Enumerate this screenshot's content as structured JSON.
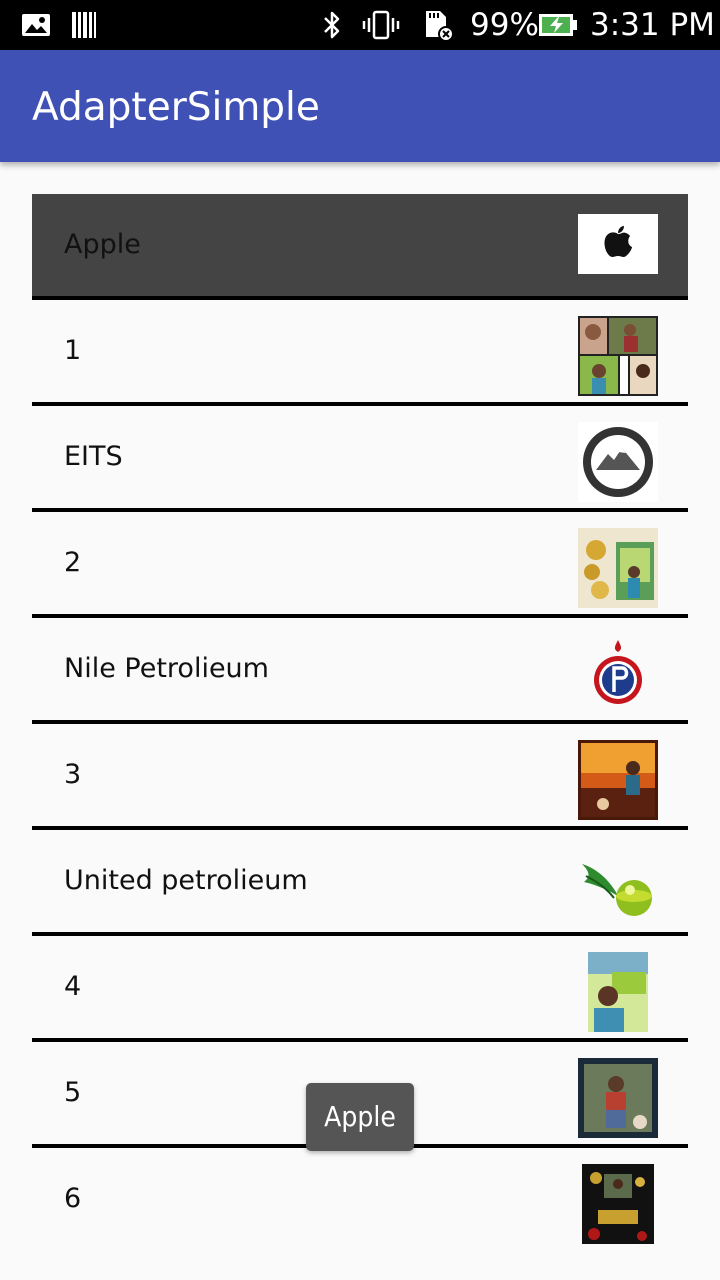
{
  "status_bar": {
    "battery_percent": "99%",
    "time": "3:31 PM",
    "icons": [
      "image-icon",
      "barcode-icon",
      "bluetooth-icon",
      "vibrate-icon",
      "sd-card-error-icon",
      "battery-charging-icon"
    ]
  },
  "app_bar": {
    "title": "AdapterSimple"
  },
  "list": {
    "items": [
      {
        "label": "Apple",
        "selected": true,
        "image": "apple-logo"
      },
      {
        "label": "1",
        "selected": false,
        "image": "photo-collage"
      },
      {
        "label": "EITS",
        "selected": false,
        "image": "everest-advanced-logo"
      },
      {
        "label": "2",
        "selected": false,
        "image": "new-year-photo-frame"
      },
      {
        "label": "Nile Petrolieum",
        "selected": false,
        "image": "nile-petroleum-logo"
      },
      {
        "label": "3",
        "selected": false,
        "image": "sunset-photo-frame"
      },
      {
        "label": "United petrolieum",
        "selected": false,
        "image": "united-petroleum-logo"
      },
      {
        "label": "4",
        "selected": false,
        "image": "selfie-photo"
      },
      {
        "label": "5",
        "selected": false,
        "image": "framed-photo"
      },
      {
        "label": "6",
        "selected": false,
        "image": "new-year-2017-photo"
      }
    ]
  },
  "toast": {
    "text": "Apple"
  },
  "colors": {
    "app_bar": "#3f51b5",
    "selected_row": "#444444",
    "divider": "#000000",
    "background": "#fafafa",
    "toast": "#555555"
  }
}
